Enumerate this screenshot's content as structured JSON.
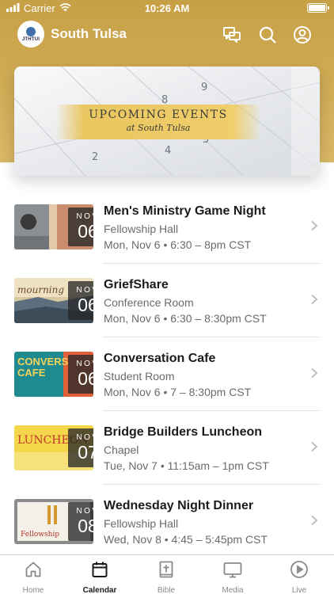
{
  "status_bar": {
    "carrier": "Carrier",
    "time": "10:26 AM"
  },
  "header": {
    "logo_text": "JTHTUI",
    "title": "South Tulsa",
    "icons": [
      "chat-icon",
      "search-icon",
      "profile-icon"
    ]
  },
  "banner": {
    "title": "UPCOMING EVENTS",
    "subtitle": "at South Tulsa"
  },
  "events": [
    {
      "title": "Men's Ministry Game Night",
      "location": "Fellowship Hall",
      "time": "Mon, Nov 6 • 6:30 – 8pm CST",
      "month": "NOV",
      "day": "06",
      "thumb_text": ""
    },
    {
      "title": "GriefShare",
      "location": "Conference Room",
      "time": "Mon, Nov 6 • 6:30 – 8:30pm CST",
      "month": "NOV",
      "day": "06",
      "thumb_text": "mourning"
    },
    {
      "title": "Conversation Cafe",
      "location": "Student Room",
      "time": "Mon, Nov 6 • 7 – 8:30pm CST",
      "month": "NOV",
      "day": "06",
      "thumb_text": "CONVERS CAFE"
    },
    {
      "title": "Bridge Builders Luncheon",
      "location": "Chapel",
      "time": "Tue, Nov 7 • 11:15am – 1pm CST",
      "month": "NOV",
      "day": "07",
      "thumb_text": "LUNCHEON"
    },
    {
      "title": "Wednesday Night Dinner",
      "location": "Fellowship Hall",
      "time": "Wed, Nov 8 • 4:45 – 5:45pm CST",
      "month": "NOV",
      "day": "08",
      "thumb_text": "Fellowship"
    }
  ],
  "tabs": [
    {
      "label": "Home",
      "icon": "home-icon",
      "active": false
    },
    {
      "label": "Calendar",
      "icon": "calendar-icon",
      "active": true
    },
    {
      "label": "Bible",
      "icon": "bible-icon",
      "active": false
    },
    {
      "label": "Media",
      "icon": "media-icon",
      "active": false
    },
    {
      "label": "Live",
      "icon": "live-icon",
      "active": false
    }
  ],
  "colors": {
    "header_gold": "#c9a24a",
    "active_tab": "#1b1b1b",
    "inactive_tab": "#8a8a8a"
  }
}
